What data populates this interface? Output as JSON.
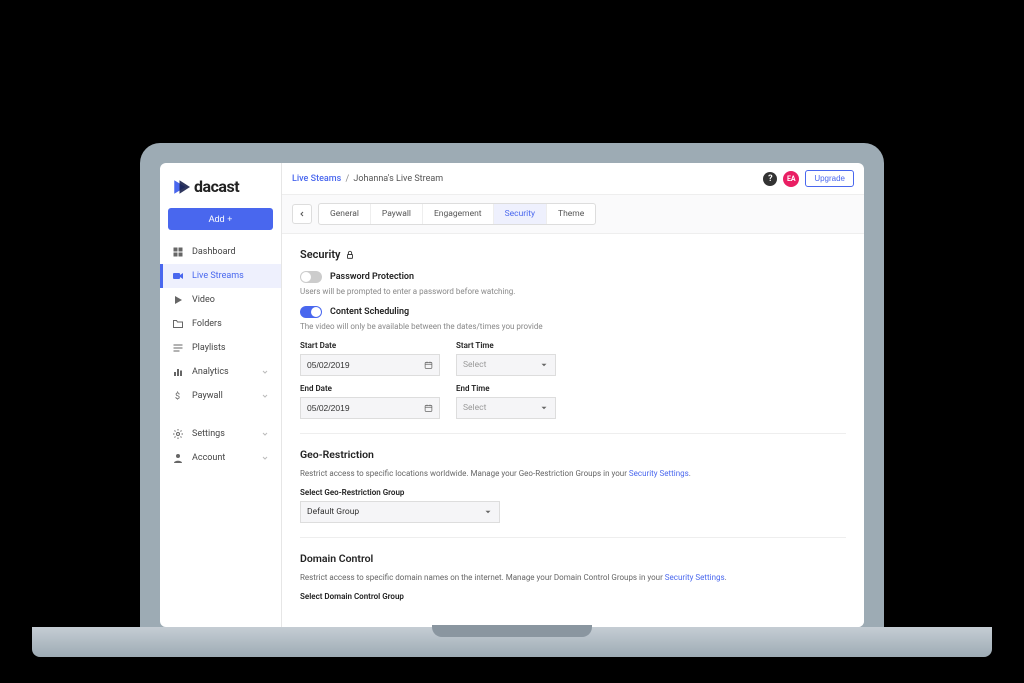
{
  "brand": {
    "name": "dacast"
  },
  "sidebar": {
    "add_label": "Add +",
    "items": [
      {
        "label": "Dashboard"
      },
      {
        "label": "Live Streams"
      },
      {
        "label": "Video"
      },
      {
        "label": "Folders"
      },
      {
        "label": "Playlists"
      },
      {
        "label": "Analytics"
      },
      {
        "label": "Paywall"
      }
    ],
    "bottom": [
      {
        "label": "Settings"
      },
      {
        "label": "Account"
      }
    ]
  },
  "topbar": {
    "breadcrumb_root": "Live Steams",
    "breadcrumb_current": "Johanna's Live Stream",
    "avatar_initials": "EA",
    "upgrade": "Upgrade"
  },
  "tabs": [
    {
      "label": "General"
    },
    {
      "label": "Paywall"
    },
    {
      "label": "Engagement"
    },
    {
      "label": "Security"
    },
    {
      "label": "Theme"
    }
  ],
  "security": {
    "title": "Security",
    "password_protection": {
      "label": "Password Protection",
      "helper": "Users will be prompted to enter a password before watching."
    },
    "content_scheduling": {
      "label": "Content Scheduling",
      "helper": "The video will only be available between the dates/times you provide",
      "start_date_label": "Start Date",
      "start_date_value": "05/02/2019",
      "start_time_label": "Start Time",
      "start_time_placeholder": "Select",
      "end_date_label": "End Date",
      "end_date_value": "05/02/2019",
      "end_time_label": "End Time",
      "end_time_placeholder": "Select"
    },
    "geo": {
      "title": "Geo-Restriction",
      "desc_pre": "Restrict access to specific locations worldwide. Manage your Geo-Restriction Groups in your ",
      "desc_link": "Security Settings",
      "select_label": "Select Geo-Restriction Group",
      "select_value": "Default Group"
    },
    "domain": {
      "title": "Domain Control",
      "desc_pre": "Restrict access to specific domain names on the internet. Manage your Domain Control Groups in your ",
      "desc_link": "Security Settings",
      "select_label": "Select Domain Control Group"
    }
  }
}
